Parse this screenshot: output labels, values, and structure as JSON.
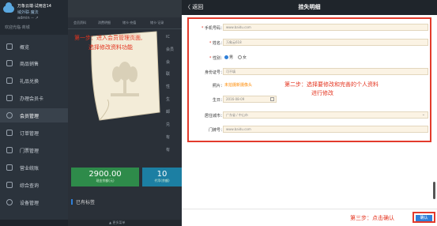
{
  "brand": {
    "name": "万象云端·试用店14",
    "line2": "域外联·魔法",
    "line3": "admin -- ↗",
    "line4": "欢迎光临·商城"
  },
  "sidebar": {
    "items": [
      {
        "label": "概览"
      },
      {
        "label": "商品销售"
      },
      {
        "label": "礼品兑换"
      },
      {
        "label": "办理会员卡"
      },
      {
        "label": "会员管理"
      },
      {
        "label": "订单管理"
      },
      {
        "label": "门票管理"
      },
      {
        "label": "营业统账"
      },
      {
        "label": "综合查询"
      },
      {
        "label": "设备管理"
      }
    ]
  },
  "mid": {
    "tabs": [
      "会员资料",
      "消费明细",
      "储卡·充值",
      "储卡·记录"
    ],
    "cards": [
      {
        "value": "2900.00",
        "sub": "现金余额(元)"
      },
      {
        "value": "10",
        "sub": "代币(余额)"
      }
    ],
    "tag_section": "已有标签",
    "bottom_label": "▲ 更多菜单",
    "right_items": [
      "IC",
      "会员",
      "会",
      "联",
      "性",
      "生",
      "邮",
      "兑",
      "有",
      "有"
    ]
  },
  "annotations": {
    "step1_line1": "第一步：进入会员管理页面,",
    "step1_line2": "选择修改资料功能",
    "step2_line1": "第二步：选择要修改和完善的个人资料",
    "step2_line2": "进行修改",
    "step3": "第三步：点击确认"
  },
  "panel": {
    "back": "〈 返回",
    "title": "挂失明细",
    "fields": {
      "phone": {
        "label": "手机号码：",
        "value": "www.baidu.com"
      },
      "name": {
        "label": "姓名：",
        "value": "万象云618"
      },
      "gender": {
        "label": "性别：",
        "options": [
          "男",
          "女"
        ],
        "selected": "男"
      },
      "id_card": {
        "label": "身份证号：",
        "value": "可不填"
      },
      "photo": {
        "label": "照片：",
        "value": "未拍摄新摄像头"
      },
      "birthday": {
        "label": "生日：",
        "value": "2016-08-09"
      },
      "city": {
        "label": "居住城市：",
        "value": "广东省 / 中山市"
      },
      "door": {
        "label": "门牌号：",
        "value": "www.baidu.com"
      }
    },
    "confirm": "确认"
  },
  "colors": {
    "accent": "#2f7fd8",
    "annotation": "#e33b2c",
    "sidebar": "#2b333c",
    "input_bg": "#fbf3e4",
    "card_green": "#2e8b4a",
    "card_blue": "#1c7fa3"
  }
}
